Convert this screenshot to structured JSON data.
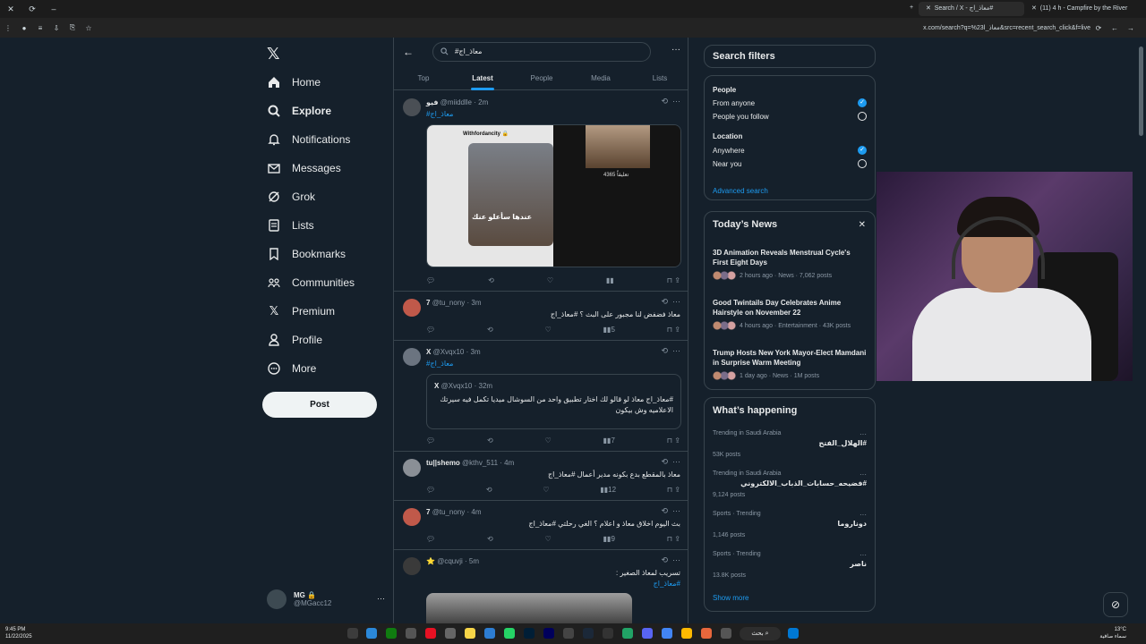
{
  "browser": {
    "tabs": [
      {
        "label": "Search / X - معاذ_اج#"
      },
      {
        "label": "(11) 4 h - Campfire by the River"
      }
    ],
    "url": "x.com/search?q=%23معاذ_ا&src=recent_search_click&f=live"
  },
  "nav": {
    "items": [
      {
        "label": "Home"
      },
      {
        "label": "Explore"
      },
      {
        "label": "Notifications"
      },
      {
        "label": "Messages"
      },
      {
        "label": "Grok"
      },
      {
        "label": "Lists"
      },
      {
        "label": "Bookmarks"
      },
      {
        "label": "Communities"
      },
      {
        "label": "Premium"
      },
      {
        "label": "Profile"
      },
      {
        "label": "More"
      }
    ],
    "post_label": "Post",
    "account": {
      "name": "MG 🔒",
      "handle": "@MGacc12"
    }
  },
  "search": {
    "query": "#معاذ_اج",
    "tabs": [
      {
        "label": "Top"
      },
      {
        "label": "Latest"
      },
      {
        "label": "People"
      },
      {
        "label": "Media"
      },
      {
        "label": "Lists"
      }
    ],
    "active_tab": "Latest"
  },
  "tweets": [
    {
      "name": "فيو",
      "handle": "@miiddlle · 2m",
      "text": "#معاذ_اج",
      "media": {
        "watermark": "Withfordancity 🔒",
        "caption": "عندها سأعلو عنك",
        "count": "4365 تعليقاً"
      },
      "actions": {
        "reply": "",
        "retweet": "",
        "like": "",
        "views": ""
      }
    },
    {
      "name": "7",
      "handle": "@tu_nony · 3m",
      "text": "معاذ فضفض لنا مجبور على البث ؟ #معاذ_اج",
      "actions": {
        "reply": "",
        "retweet": "",
        "like": "",
        "views": "5"
      }
    },
    {
      "name": "X",
      "handle": "@Xvqx10 · 3m",
      "text": "#معاذ_اج",
      "quote": {
        "name": "X",
        "handle": "@Xvqx10 · 32m",
        "text": "#معاذ_اج معاذ لو قالو لك اختار تطبيق واحد من السوشال ميديا تكمل فيه سيرتك الاعلاميه وش بيكون"
      },
      "actions": {
        "reply": "",
        "retweet": "",
        "like": "",
        "views": "7"
      }
    },
    {
      "name": "tu||shemo",
      "handle": "@kthv_511 · 4m",
      "text": "معاذ بالمقطع بدع بكونه مدير أعمال #معاذ_اج",
      "actions": {
        "reply": "",
        "retweet": "",
        "like": "",
        "views": "12"
      }
    },
    {
      "name": "7",
      "handle": "@tu_nony · 4m",
      "text": "بث اليوم اخلاق معاذ و اعلام ؟ الغي رحلتي #معاذ_اج",
      "actions": {
        "reply": "",
        "retweet": "",
        "like": "",
        "views": "9"
      }
    },
    {
      "name": "⭐",
      "handle": "@cquvji · 5m",
      "text": "تسريب لمعاذ الصغير :",
      "text2": "#معاذ_اج",
      "actions": {
        "reply": "",
        "retweet": "",
        "like": "",
        "views": ""
      }
    }
  ],
  "filters": {
    "title": "Search filters",
    "people_label": "People",
    "people_options": [
      {
        "label": "From anyone",
        "selected": true
      },
      {
        "label": "People you follow",
        "selected": false
      }
    ],
    "location_label": "Location",
    "location_options": [
      {
        "label": "Anywhere",
        "selected": true
      },
      {
        "label": "Near you",
        "selected": false
      }
    ],
    "advanced": "Advanced search"
  },
  "news": {
    "title": "Today’s News",
    "items": [
      {
        "title": "3D Animation Reveals Menstrual Cycle's First Eight Days",
        "meta": "2 hours ago · News · 7,062 posts"
      },
      {
        "title": "Good Twintails Day Celebrates Anime Hairstyle on November 22",
        "meta": "4 hours ago · Entertainment · 43K posts"
      },
      {
        "title": "Trump Hosts New York Mayor-Elect Mamdani in Surprise Warm Meeting",
        "meta": "1 day ago · News · 1M posts"
      }
    ]
  },
  "happening": {
    "title": "What’s happening",
    "items": [
      {
        "context": "Trending in Saudi Arabia",
        "title": "#الهلال_الفتح",
        "count": "53K posts"
      },
      {
        "context": "Trending in Saudi Arabia",
        "title": "#فضيحه_حسابات_الذباب_الالكتروني",
        "count": "9,124 posts"
      },
      {
        "context": "Sports · Trending",
        "title": "دوناروما",
        "count": "1,146 posts"
      },
      {
        "context": "Sports · Trending",
        "title": "ناصر",
        "count": "13.8K posts"
      }
    ],
    "show_more": "Show more"
  },
  "taskbar": {
    "time": "9:45 PM",
    "date": "11/22/2025",
    "search_label": "بحث",
    "weather_temp": "13°C",
    "weather_desc": "سماء صافية"
  },
  "colors": {
    "bg": "#15202b",
    "accent": "#1d9bf0",
    "border": "#38444d",
    "muted": "#8b98a5"
  }
}
